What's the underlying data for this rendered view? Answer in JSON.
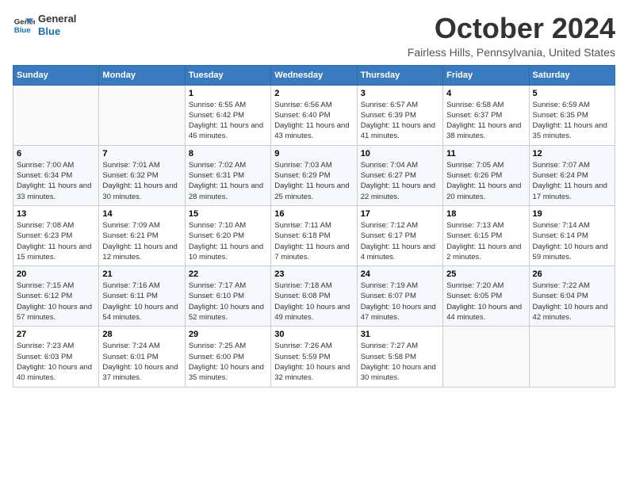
{
  "logo": {
    "line1": "General",
    "line2": "Blue"
  },
  "title": "October 2024",
  "location": "Fairless Hills, Pennsylvania, United States",
  "weekdays": [
    "Sunday",
    "Monday",
    "Tuesday",
    "Wednesday",
    "Thursday",
    "Friday",
    "Saturday"
  ],
  "weeks": [
    [
      {
        "day": "",
        "sunrise": "",
        "sunset": "",
        "daylight": ""
      },
      {
        "day": "",
        "sunrise": "",
        "sunset": "",
        "daylight": ""
      },
      {
        "day": "1",
        "sunrise": "Sunrise: 6:55 AM",
        "sunset": "Sunset: 6:42 PM",
        "daylight": "Daylight: 11 hours and 46 minutes."
      },
      {
        "day": "2",
        "sunrise": "Sunrise: 6:56 AM",
        "sunset": "Sunset: 6:40 PM",
        "daylight": "Daylight: 11 hours and 43 minutes."
      },
      {
        "day": "3",
        "sunrise": "Sunrise: 6:57 AM",
        "sunset": "Sunset: 6:39 PM",
        "daylight": "Daylight: 11 hours and 41 minutes."
      },
      {
        "day": "4",
        "sunrise": "Sunrise: 6:58 AM",
        "sunset": "Sunset: 6:37 PM",
        "daylight": "Daylight: 11 hours and 38 minutes."
      },
      {
        "day": "5",
        "sunrise": "Sunrise: 6:59 AM",
        "sunset": "Sunset: 6:35 PM",
        "daylight": "Daylight: 11 hours and 35 minutes."
      }
    ],
    [
      {
        "day": "6",
        "sunrise": "Sunrise: 7:00 AM",
        "sunset": "Sunset: 6:34 PM",
        "daylight": "Daylight: 11 hours and 33 minutes."
      },
      {
        "day": "7",
        "sunrise": "Sunrise: 7:01 AM",
        "sunset": "Sunset: 6:32 PM",
        "daylight": "Daylight: 11 hours and 30 minutes."
      },
      {
        "day": "8",
        "sunrise": "Sunrise: 7:02 AM",
        "sunset": "Sunset: 6:31 PM",
        "daylight": "Daylight: 11 hours and 28 minutes."
      },
      {
        "day": "9",
        "sunrise": "Sunrise: 7:03 AM",
        "sunset": "Sunset: 6:29 PM",
        "daylight": "Daylight: 11 hours and 25 minutes."
      },
      {
        "day": "10",
        "sunrise": "Sunrise: 7:04 AM",
        "sunset": "Sunset: 6:27 PM",
        "daylight": "Daylight: 11 hours and 22 minutes."
      },
      {
        "day": "11",
        "sunrise": "Sunrise: 7:05 AM",
        "sunset": "Sunset: 6:26 PM",
        "daylight": "Daylight: 11 hours and 20 minutes."
      },
      {
        "day": "12",
        "sunrise": "Sunrise: 7:07 AM",
        "sunset": "Sunset: 6:24 PM",
        "daylight": "Daylight: 11 hours and 17 minutes."
      }
    ],
    [
      {
        "day": "13",
        "sunrise": "Sunrise: 7:08 AM",
        "sunset": "Sunset: 6:23 PM",
        "daylight": "Daylight: 11 hours and 15 minutes."
      },
      {
        "day": "14",
        "sunrise": "Sunrise: 7:09 AM",
        "sunset": "Sunset: 6:21 PM",
        "daylight": "Daylight: 11 hours and 12 minutes."
      },
      {
        "day": "15",
        "sunrise": "Sunrise: 7:10 AM",
        "sunset": "Sunset: 6:20 PM",
        "daylight": "Daylight: 11 hours and 10 minutes."
      },
      {
        "day": "16",
        "sunrise": "Sunrise: 7:11 AM",
        "sunset": "Sunset: 6:18 PM",
        "daylight": "Daylight: 11 hours and 7 minutes."
      },
      {
        "day": "17",
        "sunrise": "Sunrise: 7:12 AM",
        "sunset": "Sunset: 6:17 PM",
        "daylight": "Daylight: 11 hours and 4 minutes."
      },
      {
        "day": "18",
        "sunrise": "Sunrise: 7:13 AM",
        "sunset": "Sunset: 6:15 PM",
        "daylight": "Daylight: 11 hours and 2 minutes."
      },
      {
        "day": "19",
        "sunrise": "Sunrise: 7:14 AM",
        "sunset": "Sunset: 6:14 PM",
        "daylight": "Daylight: 10 hours and 59 minutes."
      }
    ],
    [
      {
        "day": "20",
        "sunrise": "Sunrise: 7:15 AM",
        "sunset": "Sunset: 6:12 PM",
        "daylight": "Daylight: 10 hours and 57 minutes."
      },
      {
        "day": "21",
        "sunrise": "Sunrise: 7:16 AM",
        "sunset": "Sunset: 6:11 PM",
        "daylight": "Daylight: 10 hours and 54 minutes."
      },
      {
        "day": "22",
        "sunrise": "Sunrise: 7:17 AM",
        "sunset": "Sunset: 6:10 PM",
        "daylight": "Daylight: 10 hours and 52 minutes."
      },
      {
        "day": "23",
        "sunrise": "Sunrise: 7:18 AM",
        "sunset": "Sunset: 6:08 PM",
        "daylight": "Daylight: 10 hours and 49 minutes."
      },
      {
        "day": "24",
        "sunrise": "Sunrise: 7:19 AM",
        "sunset": "Sunset: 6:07 PM",
        "daylight": "Daylight: 10 hours and 47 minutes."
      },
      {
        "day": "25",
        "sunrise": "Sunrise: 7:20 AM",
        "sunset": "Sunset: 6:05 PM",
        "daylight": "Daylight: 10 hours and 44 minutes."
      },
      {
        "day": "26",
        "sunrise": "Sunrise: 7:22 AM",
        "sunset": "Sunset: 6:04 PM",
        "daylight": "Daylight: 10 hours and 42 minutes."
      }
    ],
    [
      {
        "day": "27",
        "sunrise": "Sunrise: 7:23 AM",
        "sunset": "Sunset: 6:03 PM",
        "daylight": "Daylight: 10 hours and 40 minutes."
      },
      {
        "day": "28",
        "sunrise": "Sunrise: 7:24 AM",
        "sunset": "Sunset: 6:01 PM",
        "daylight": "Daylight: 10 hours and 37 minutes."
      },
      {
        "day": "29",
        "sunrise": "Sunrise: 7:25 AM",
        "sunset": "Sunset: 6:00 PM",
        "daylight": "Daylight: 10 hours and 35 minutes."
      },
      {
        "day": "30",
        "sunrise": "Sunrise: 7:26 AM",
        "sunset": "Sunset: 5:59 PM",
        "daylight": "Daylight: 10 hours and 32 minutes."
      },
      {
        "day": "31",
        "sunrise": "Sunrise: 7:27 AM",
        "sunset": "Sunset: 5:58 PM",
        "daylight": "Daylight: 10 hours and 30 minutes."
      },
      {
        "day": "",
        "sunrise": "",
        "sunset": "",
        "daylight": ""
      },
      {
        "day": "",
        "sunrise": "",
        "sunset": "",
        "daylight": ""
      }
    ]
  ]
}
